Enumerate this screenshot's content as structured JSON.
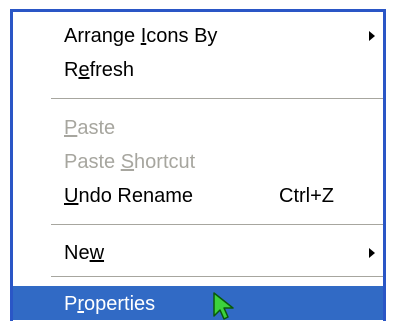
{
  "context_menu": {
    "items": [
      {
        "label_pre": "Arrange ",
        "label_key": "I",
        "label_post": "cons By",
        "submenu": true
      },
      {
        "label_pre": "R",
        "label_key": "e",
        "label_post": "fresh"
      },
      {
        "label_pre": "",
        "label_key": "P",
        "label_post": "aste",
        "disabled": true
      },
      {
        "label_pre": "Paste ",
        "label_key": "S",
        "label_post": "hortcut",
        "disabled": true
      },
      {
        "label_pre": "",
        "label_key": "U",
        "label_post": "ndo Rename",
        "shortcut": "Ctrl+Z"
      },
      {
        "label_pre": "Ne",
        "label_key": "w",
        "label_post": "",
        "submenu": true
      },
      {
        "label_pre": "P",
        "label_key": "r",
        "label_post": "operties",
        "highlighted": true
      }
    ]
  },
  "colors": {
    "highlight": "#316ac5",
    "border": "#2a56c6",
    "disabled_text": "#a7a69f",
    "cursor_fill": "#3cd23c"
  },
  "icons": {
    "submenu_arrow": "triangle-right",
    "cursor": "arrow-pointer"
  }
}
